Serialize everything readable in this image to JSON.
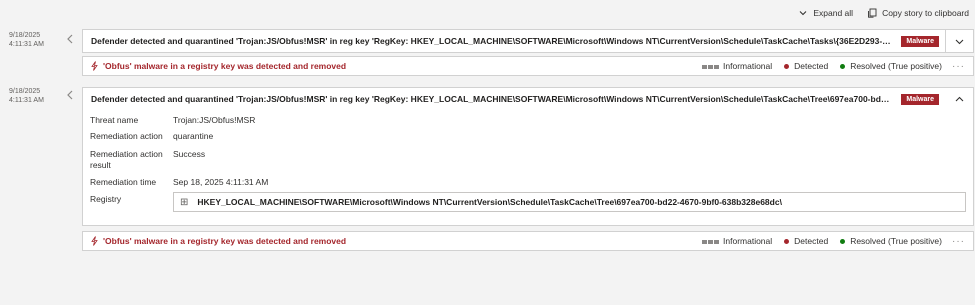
{
  "toolbar": {
    "expand_all": "Expand all",
    "copy_story": "Copy story to clipboard"
  },
  "events": [
    {
      "date": "9/18/2025",
      "time": "4:11:31 AM",
      "title": "Defender detected and quarantined 'Trojan:JS/Obfus!MSR' in reg key 'RegKey: HKEY_LOCAL_MACHINE\\SOFTWARE\\Microsoft\\Windows NT\\CurrentVersion\\Schedule\\TaskCache\\Tasks\\{36E2D293-A247-...",
      "badge": "Malware"
    },
    {
      "date": "9/18/2025",
      "time": "4:11:31 AM",
      "title": "Defender detected and quarantined 'Trojan:JS/Obfus!MSR' in reg key 'RegKey: HKEY_LOCAL_MACHINE\\SOFTWARE\\Microsoft\\Windows NT\\CurrentVersion\\Schedule\\TaskCache\\Tree\\697ea700-bd22-46...",
      "badge": "Malware"
    }
  ],
  "alerts": [
    {
      "title": "'Obfus' malware in a registry key was detected and removed",
      "severity": "Informational",
      "status": "Detected",
      "classification": "Resolved (True positive)"
    },
    {
      "title": "'Obfus' malware in a registry key was detected and removed",
      "severity": "Informational",
      "status": "Detected",
      "classification": "Resolved (True positive)"
    }
  ],
  "details": {
    "threat_name_label": "Threat name",
    "threat_name": "Trojan:JS/Obfus!MSR",
    "remediation_action_label": "Remediation action",
    "remediation_action": "quarantine",
    "remediation_result_label": "Remediation action result",
    "remediation_result": "Success",
    "remediation_time_label": "Remediation time",
    "remediation_time": "Sep 18, 2025 4:11:31 AM",
    "registry_label": "Registry",
    "registry_value": "HKEY_LOCAL_MACHINE\\SOFTWARE\\Microsoft\\Windows NT\\CurrentVersion\\Schedule\\TaskCache\\Tree\\697ea700-bd22-4670-9bf0-638b328e68dc\\"
  },
  "colors": {
    "malware_badge": "#a4262c",
    "alert_title": "#a4262c",
    "detected_dot": "#a4262c",
    "resolved_dot": "#107c10"
  }
}
